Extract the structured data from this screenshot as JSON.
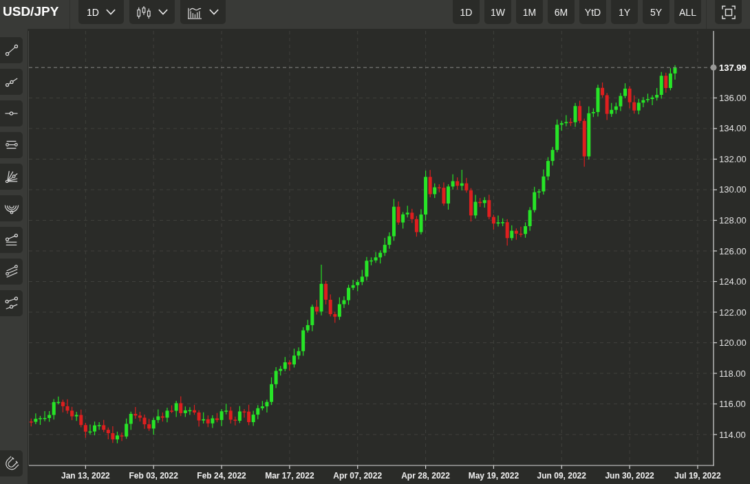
{
  "symbol": "USD/JPY",
  "toolbar": {
    "interval": "1D",
    "ranges": [
      {
        "label": "1D",
        "selected": false
      },
      {
        "label": "1W",
        "selected": false
      },
      {
        "label": "1M",
        "selected": false
      },
      {
        "label": "6M",
        "selected": false
      },
      {
        "label": "YtD",
        "selected": false
      },
      {
        "label": "1Y",
        "selected": false
      },
      {
        "label": "5Y",
        "selected": false
      },
      {
        "label": "ALL",
        "selected": false
      }
    ]
  },
  "chart": {
    "chart_data": {
      "type": "candlestick",
      "grid": true,
      "ylim": [
        111.98,
        140.38
      ],
      "yticks": [
        {
          "value": 136,
          "label": "136.00"
        },
        {
          "value": 134,
          "label": "134.00"
        },
        {
          "value": 132,
          "label": "132.00"
        },
        {
          "value": 130,
          "label": "130.00"
        },
        {
          "value": 128,
          "label": "128.00"
        },
        {
          "value": 126,
          "label": "126.00"
        },
        {
          "value": 124,
          "label": "124.00"
        },
        {
          "value": 122,
          "label": "122.00"
        },
        {
          "value": 120,
          "label": "120.00"
        },
        {
          "value": 118,
          "label": "118.00"
        },
        {
          "value": 116,
          "label": "116.00"
        },
        {
          "value": 114,
          "label": "114.00"
        }
      ],
      "ref_lines": [
        {
          "axis": "y",
          "value": 137.99,
          "label": "137.99",
          "color": "#8a8a88"
        }
      ],
      "categories": [
        null,
        null,
        null,
        null,
        null,
        null,
        null,
        null,
        null,
        null,
        null,
        null,
        "Jan 13, 2022",
        null,
        null,
        null,
        null,
        null,
        null,
        null,
        null,
        null,
        null,
        null,
        null,
        null,
        null,
        "Feb 03, 2022",
        null,
        null,
        null,
        null,
        null,
        null,
        null,
        null,
        null,
        null,
        null,
        null,
        null,
        null,
        "Feb 24, 2022",
        null,
        null,
        null,
        null,
        null,
        null,
        null,
        null,
        null,
        null,
        null,
        null,
        null,
        null,
        "Mar 17, 2022",
        null,
        null,
        null,
        null,
        null,
        null,
        null,
        null,
        null,
        null,
        null,
        null,
        null,
        null,
        "Apr 07, 2022",
        null,
        null,
        null,
        null,
        null,
        null,
        null,
        null,
        null,
        null,
        null,
        null,
        null,
        null,
        "Apr 28, 2022",
        null,
        null,
        null,
        null,
        null,
        null,
        null,
        null,
        null,
        null,
        null,
        null,
        null,
        null,
        "May 19, 2022",
        null,
        null,
        null,
        null,
        null,
        null,
        null,
        null,
        null,
        null,
        null,
        null,
        null,
        null,
        "Jun 09, 2022",
        null,
        null,
        null,
        null,
        null,
        null,
        null,
        null,
        null,
        null,
        null,
        null,
        null,
        null,
        "Jun 30, 2022",
        null,
        null,
        null,
        null,
        null,
        null,
        null,
        null,
        null,
        null,
        null,
        null,
        null,
        null,
        "Jul 19, 2022",
        null,
        null,
        null
      ],
      "ohlc": [
        [
          114.85,
          115.05,
          114.53,
          114.83
        ],
        [
          114.83,
          115.38,
          114.68,
          115.03
        ],
        [
          115.03,
          115.22,
          114.63,
          115.07
        ],
        [
          115.07,
          115.53,
          114.87,
          115.08
        ],
        [
          115.08,
          115.53,
          114.83,
          115.28
        ],
        [
          115.28,
          116.32,
          114.98,
          116.12
        ],
        [
          116.12,
          116.48,
          115.97,
          116.13
        ],
        [
          116.13,
          116.28,
          115.45,
          115.85
        ],
        [
          115.85,
          116.3,
          115.36,
          115.56
        ],
        [
          115.56,
          115.81,
          114.94,
          115.19
        ],
        [
          115.19,
          115.48,
          114.89,
          115.28
        ],
        [
          115.28,
          115.63,
          114.47,
          114.62
        ],
        [
          114.62,
          114.77,
          113.79,
          114.19
        ],
        [
          114.19,
          114.65,
          113.99,
          114.2
        ],
        [
          114.2,
          114.85,
          113.95,
          114.6
        ],
        [
          114.6,
          114.81,
          114.3,
          114.61
        ],
        [
          114.61,
          114.96,
          114.16,
          114.31
        ],
        [
          114.31,
          114.46,
          113.69,
          114.09
        ],
        [
          114.09,
          114.54,
          113.45,
          113.68
        ],
        [
          113.68,
          114.19,
          113.43,
          113.94
        ],
        [
          113.94,
          114.14,
          113.57,
          113.87
        ],
        [
          113.87,
          115.05,
          113.72,
          114.7
        ],
        [
          114.7,
          115.5,
          114.3,
          115.35
        ],
        [
          115.35,
          115.8,
          115.04,
          115.24
        ],
        [
          115.24,
          115.49,
          114.85,
          115.1
        ],
        [
          115.1,
          115.3,
          114.37,
          114.67
        ],
        [
          114.67,
          115.02,
          114.24,
          114.39
        ],
        [
          114.39,
          115.1,
          113.99,
          114.95
        ],
        [
          114.95,
          115.64,
          114.75,
          115.19
        ],
        [
          115.19,
          115.44,
          114.85,
          115.1
        ],
        [
          115.1,
          115.76,
          114.8,
          115.56
        ],
        [
          115.56,
          115.91,
          115.4,
          115.55
        ],
        [
          115.55,
          116.2,
          115.15,
          116.05
        ],
        [
          116.05,
          116.5,
          115.2,
          115.4
        ],
        [
          115.4,
          115.83,
          115.15,
          115.58
        ],
        [
          115.58,
          115.79,
          115.28,
          115.59
        ],
        [
          115.59,
          115.94,
          115.29,
          115.44
        ],
        [
          115.44,
          115.59,
          114.52,
          114.92
        ],
        [
          114.92,
          115.45,
          114.72,
          115.0
        ],
        [
          115.0,
          115.25,
          114.48,
          114.73
        ],
        [
          114.73,
          115.26,
          114.43,
          115.06
        ],
        [
          115.06,
          115.41,
          114.8,
          114.95
        ],
        [
          114.95,
          115.67,
          114.55,
          115.52
        ],
        [
          115.52,
          116.01,
          115.32,
          115.56
        ],
        [
          115.56,
          115.81,
          114.72,
          114.97
        ],
        [
          114.97,
          115.17,
          114.6,
          114.9
        ],
        [
          114.9,
          115.86,
          114.75,
          115.51
        ],
        [
          115.51,
          115.66,
          115.1,
          115.5
        ],
        [
          115.5,
          115.95,
          114.61,
          114.81
        ],
        [
          114.81,
          115.55,
          114.56,
          115.3
        ],
        [
          115.3,
          115.92,
          115.0,
          115.72
        ],
        [
          115.72,
          116.19,
          115.57,
          115.84
        ],
        [
          115.84,
          116.28,
          115.44,
          116.13
        ],
        [
          116.13,
          117.74,
          115.93,
          117.29
        ],
        [
          117.29,
          118.41,
          117.04,
          118.16
        ],
        [
          118.16,
          118.49,
          117.86,
          118.29
        ],
        [
          118.29,
          119.07,
          118.14,
          118.72
        ],
        [
          118.72,
          118.87,
          118.18,
          118.58
        ],
        [
          118.58,
          119.61,
          118.38,
          119.16
        ],
        [
          119.16,
          119.7,
          118.91,
          119.45
        ],
        [
          119.45,
          121.01,
          119.15,
          120.81
        ],
        [
          120.81,
          121.5,
          120.66,
          121.15
        ],
        [
          121.15,
          122.5,
          120.75,
          122.35
        ],
        [
          122.35,
          122.8,
          121.84,
          122.04
        ],
        [
          122.04,
          125.1,
          121.79,
          123.85
        ],
        [
          123.85,
          124.05,
          122.51,
          122.81
        ],
        [
          122.81,
          123.16,
          121.72,
          121.87
        ],
        [
          121.87,
          122.02,
          121.3,
          121.7
        ],
        [
          121.7,
          122.97,
          121.5,
          122.52
        ],
        [
          122.52,
          123.03,
          122.27,
          122.78
        ],
        [
          122.78,
          123.79,
          122.48,
          123.59
        ],
        [
          123.59,
          124.11,
          123.44,
          123.76
        ],
        [
          123.76,
          124.12,
          123.36,
          123.97
        ],
        [
          123.97,
          124.77,
          123.77,
          124.32
        ],
        [
          124.32,
          125.61,
          124.07,
          125.36
        ],
        [
          125.36,
          125.58,
          125.06,
          125.38
        ],
        [
          125.38,
          125.93,
          125.23,
          125.58
        ],
        [
          125.58,
          126.03,
          125.18,
          125.88
        ],
        [
          125.88,
          126.85,
          125.68,
          126.4
        ],
        [
          126.4,
          127.21,
          126.15,
          126.96
        ],
        [
          126.96,
          129.4,
          126.66,
          128.89
        ],
        [
          128.89,
          129.24,
          127.71,
          127.86
        ],
        [
          127.86,
          128.54,
          127.46,
          128.39
        ],
        [
          128.39,
          128.95,
          128.19,
          128.5
        ],
        [
          128.5,
          128.75,
          127.83,
          128.08
        ],
        [
          128.08,
          128.28,
          126.93,
          127.23
        ],
        [
          127.23,
          128.73,
          127.08,
          128.38
        ],
        [
          128.38,
          131.25,
          127.98,
          130.84
        ],
        [
          130.84,
          131.29,
          129.51,
          129.71
        ],
        [
          129.71,
          130.41,
          129.46,
          130.16
        ],
        [
          130.16,
          130.36,
          129.83,
          130.13
        ],
        [
          130.13,
          130.48,
          128.95,
          129.1
        ],
        [
          129.1,
          130.36,
          128.7,
          130.21
        ],
        [
          130.21,
          131.01,
          130.01,
          130.56
        ],
        [
          130.56,
          130.81,
          130.01,
          130.26
        ],
        [
          130.26,
          131.3,
          129.96,
          130.42
        ],
        [
          130.42,
          130.77,
          129.81,
          129.96
        ],
        [
          129.96,
          130.11,
          127.92,
          128.32
        ],
        [
          128.32,
          129.66,
          128.12,
          129.21
        ],
        [
          129.21,
          129.46,
          128.88,
          129.13
        ],
        [
          129.13,
          129.52,
          128.83,
          129.32
        ],
        [
          129.32,
          129.67,
          128.07,
          128.22
        ],
        [
          128.22,
          128.37,
          127.39,
          127.79
        ],
        [
          127.79,
          128.32,
          127.59,
          127.87
        ],
        [
          127.87,
          128.13,
          127.62,
          127.88
        ],
        [
          127.88,
          128.08,
          126.35,
          126.84
        ],
        [
          126.84,
          127.67,
          126.69,
          127.32
        ],
        [
          127.32,
          127.47,
          126.73,
          127.13
        ],
        [
          127.13,
          127.58,
          126.91,
          127.11
        ],
        [
          127.11,
          127.87,
          126.86,
          127.62
        ],
        [
          127.62,
          128.87,
          127.32,
          128.67
        ],
        [
          128.67,
          130.19,
          128.52,
          129.84
        ],
        [
          129.84,
          130.04,
          129.44,
          129.89
        ],
        [
          129.89,
          131.32,
          129.69,
          130.87
        ],
        [
          130.87,
          132.13,
          130.62,
          131.88
        ],
        [
          131.88,
          132.8,
          131.58,
          132.6
        ],
        [
          132.6,
          134.6,
          132.45,
          134.25
        ],
        [
          134.25,
          134.5,
          133.85,
          134.35
        ],
        [
          134.35,
          134.88,
          134.15,
          134.43
        ],
        [
          134.43,
          134.68,
          134.16,
          134.41
        ],
        [
          134.41,
          135.67,
          134.11,
          135.47
        ],
        [
          135.47,
          135.82,
          134.35,
          134.5
        ],
        [
          134.5,
          134.65,
          131.5,
          132.18
        ],
        [
          132.18,
          135.45,
          131.98,
          135.0
        ],
        [
          135.0,
          135.33,
          134.75,
          135.08
        ],
        [
          135.08,
          136.86,
          134.78,
          136.66
        ],
        [
          136.66,
          137.01,
          136.03,
          136.18
        ],
        [
          136.18,
          136.33,
          134.56,
          134.96
        ],
        [
          134.96,
          135.67,
          134.76,
          135.22
        ],
        [
          135.22,
          135.7,
          134.97,
          135.45
        ],
        [
          135.45,
          136.33,
          135.15,
          136.13
        ],
        [
          136.13,
          136.96,
          135.98,
          136.61
        ],
        [
          136.61,
          136.76,
          135.32,
          135.72
        ],
        [
          135.72,
          136.17,
          134.98,
          135.18
        ],
        [
          135.18,
          135.94,
          134.93,
          135.69
        ],
        [
          135.69,
          136.06,
          135.39,
          135.86
        ],
        [
          135.86,
          136.28,
          135.71,
          135.93
        ],
        [
          135.93,
          136.18,
          135.53,
          136.03
        ],
        [
          136.03,
          136.65,
          135.83,
          136.2
        ],
        [
          136.2,
          137.7,
          135.95,
          137.45
        ],
        [
          137.45,
          137.65,
          136.35,
          136.65
        ],
        [
          136.65,
          137.95,
          136.5,
          137.6
        ],
        [
          137.6,
          138.14,
          137.2,
          137.99
        ],
        null,
        null,
        null,
        null,
        null,
        null,
        null,
        null
      ]
    }
  }
}
